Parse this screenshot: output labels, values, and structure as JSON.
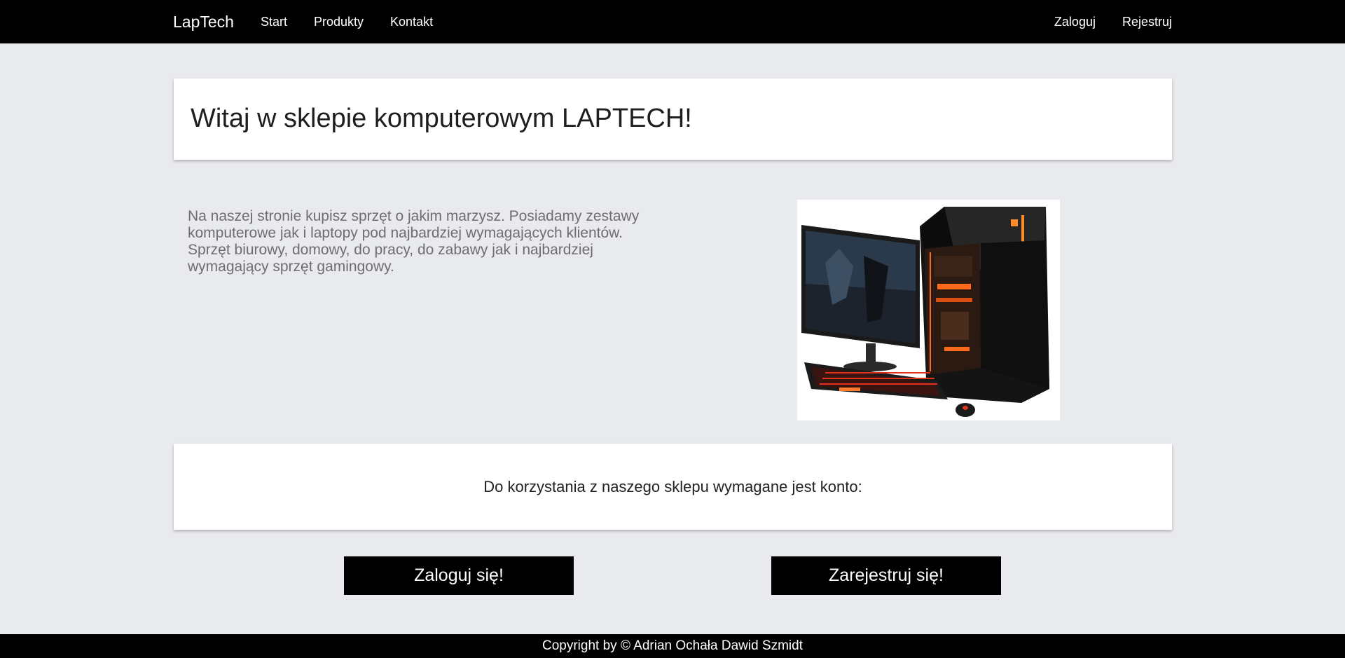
{
  "nav": {
    "brand": "LapTech",
    "links": [
      "Start",
      "Produkty",
      "Kontakt"
    ],
    "right_links": [
      "Zaloguj",
      "Rejestruj"
    ]
  },
  "hero": {
    "title": "Witaj w sklepie komputerowym LAPTECH!"
  },
  "intro": {
    "text": "Na naszej stronie kupisz sprzęt o jakim marzysz. Posiadamy zestawy komputerowe jak i laptopy pod najbardziej wymagających klientów. Sprzęt biurowy, domowy, do pracy, do zabawy jak i najbardziej wymagający sprzęt gamingowy."
  },
  "image": {
    "icon": "gaming-pc-icon"
  },
  "account": {
    "text": "Do korzystania z naszego sklepu wymagane jest konto:",
    "login_button": "Zaloguj się!",
    "register_button": "Zarejestruj się!"
  },
  "footer": {
    "text": "Copyright by © Adrian Ochała Dawid Szmidt"
  },
  "colors": {
    "nav_bg": "#000000",
    "page_bg": "#e9eaee",
    "card_bg": "#ffffff",
    "button_bg": "#000000",
    "accent_orange": "#ff6a1a"
  }
}
